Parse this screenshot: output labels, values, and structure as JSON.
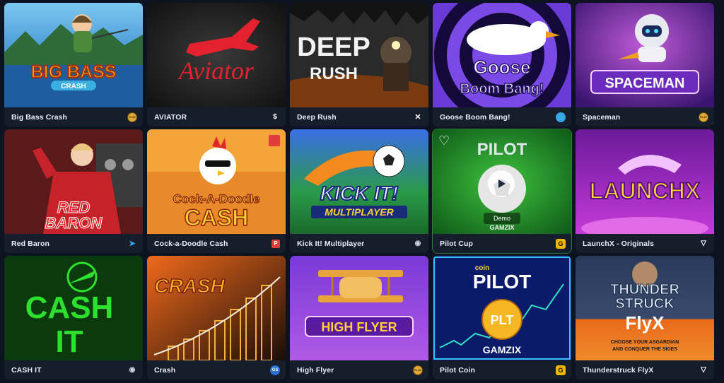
{
  "games": [
    {
      "name": "Big Bass Crash",
      "art": [
        "BIG BASS",
        "CRASH"
      ],
      "provider": "play-icon",
      "provider_label": "PLAY"
    },
    {
      "name": "AVIATOR",
      "art": [
        "Aviator"
      ],
      "provider": "spribe-icon",
      "provider_label": "$"
    },
    {
      "name": "Deep Rush",
      "art": [
        "DEEP",
        "RUSH"
      ],
      "provider": "x-icon",
      "provider_label": "✕"
    },
    {
      "name": "Goose Boom Bang!",
      "art": [
        "Goose",
        "Boom Bang!"
      ],
      "provider": "goose-icon",
      "provider_label": ""
    },
    {
      "name": "Spaceman",
      "art": [
        "SPACEMAN"
      ],
      "provider": "play-icon",
      "provider_label": "PLAY"
    },
    {
      "name": "Red Baron",
      "art": [
        "RED",
        "BARON"
      ],
      "provider": "arrow-icon",
      "provider_label": "➤"
    },
    {
      "name": "Cock-a-Doodle Cash",
      "art": [
        "Cock-A-Doodle",
        "CASH"
      ],
      "provider": "p-icon",
      "provider_label": "P"
    },
    {
      "name": "Kick It! Multiplayer",
      "art": [
        "KICK IT!",
        "MULTIPLAYER"
      ],
      "provider": "eye-icon",
      "provider_label": "◉"
    },
    {
      "name": "Pilot Cup",
      "art": [
        "PILOT",
        "GAMZIX"
      ],
      "provider": "g-icon",
      "provider_label": "G",
      "demo_label": "Demo"
    },
    {
      "name": "LaunchX - Originals",
      "art": [
        "LAUNCHX"
      ],
      "provider": "triangle-icon",
      "provider_label": "▽"
    },
    {
      "name": "CASH IT",
      "art": [
        "CASH",
        "IT"
      ],
      "provider": "eye-icon",
      "provider_label": "◉"
    },
    {
      "name": "Crash",
      "art": [
        "CRASH"
      ],
      "provider": "gs-icon",
      "provider_label": "GS"
    },
    {
      "name": "High Flyer",
      "art": [
        "HIGH FLYER"
      ],
      "provider": "play-icon",
      "provider_label": "PLAY"
    },
    {
      "name": "Pilot Coin",
      "art": [
        "coin",
        "PILOT",
        "PLT",
        "GAMZIX"
      ],
      "provider": "g-icon",
      "provider_label": "G"
    },
    {
      "name": "Thunderstruck FlyX",
      "art": [
        "THUNDER",
        "STRUCK",
        "FlyX",
        "CHOOSE YOUR ASGARDIAN",
        "AND CONQUER THE SKIES"
      ],
      "provider": "triangle-icon",
      "provider_label": "▽"
    }
  ],
  "colors": {
    "page_bg": "#0d1320",
    "card_caption_bg": "#161d2b"
  }
}
